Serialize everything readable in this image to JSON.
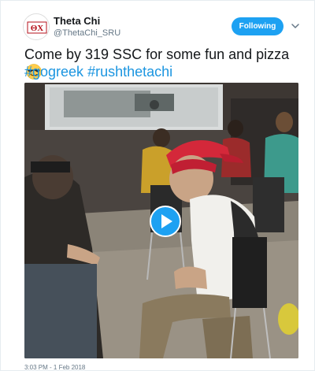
{
  "tweet": {
    "author_name": "Theta Chi",
    "author_handle": "@ThetaChi_SRU",
    "follow_label": "Following",
    "text": "Come by 319 SSC for some fun and pizza",
    "emoji": "smiling-face-with-sunglasses",
    "hashtags": [
      "#gogreek",
      "#rushthetachi"
    ],
    "timestamp": "3:03 PM - 1 Feb 2018"
  },
  "avatar": {
    "logo_text": "ΘΧ"
  },
  "colors": {
    "accent": "#1da1f2",
    "hashtag": "#1b95e0",
    "text": "#14171a",
    "secondary": "#657786",
    "logo_red": "#b5121b"
  },
  "icons": {
    "caret": "chevron-down-icon",
    "play": "play-icon"
  }
}
